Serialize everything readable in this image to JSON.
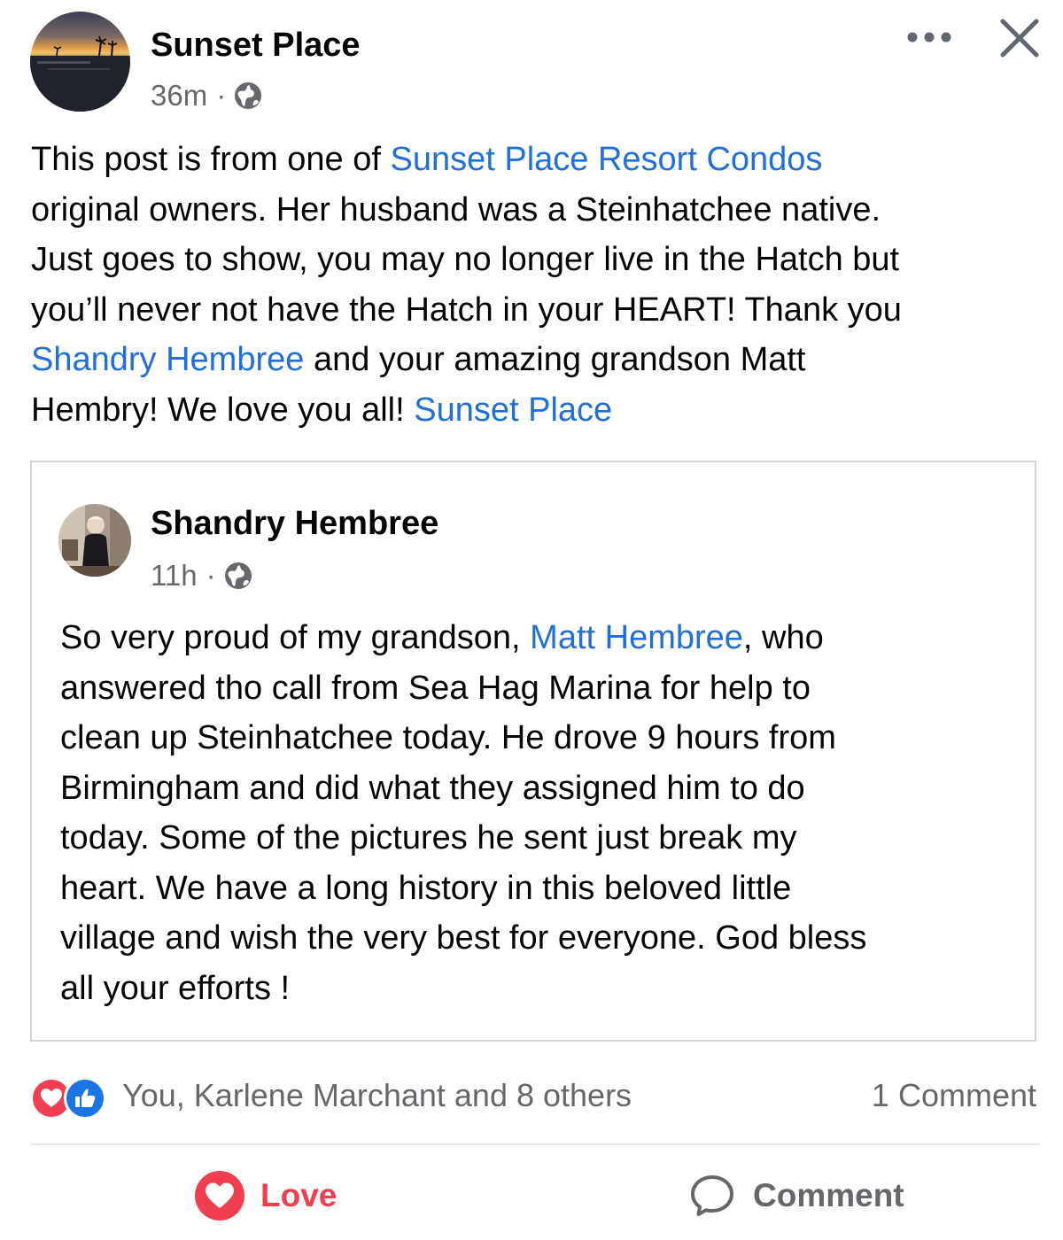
{
  "post": {
    "author": "Sunset Place",
    "time": "36m",
    "separator": "·",
    "lines": [
      [
        {
          "t": "This post is from one of "
        },
        {
          "t": "Sunset Place Resort Condos",
          "link": true
        }
      ],
      [
        {
          "t": "original owners. Her husband was a Steinhatchee native."
        }
      ],
      [
        {
          "t": "Just goes to show, you may no longer live in the Hatch but"
        }
      ],
      [
        {
          "t": "you’ll never not have the Hatch in your HEART! Thank you"
        }
      ],
      [
        {
          "t": "Shandry Hembree",
          "link": true
        },
        {
          "t": " and your amazing grandson Matt"
        }
      ],
      [
        {
          "t": "Hembry! We love you all! "
        },
        {
          "t": "Sunset Place",
          "link": true
        }
      ]
    ]
  },
  "shared": {
    "author": "Shandry Hembree",
    "time": "11h",
    "separator": "·",
    "lines": [
      [
        {
          "t": "So very proud of my grandson, "
        },
        {
          "t": "Matt Hembree",
          "link": true
        },
        {
          "t": ", who"
        }
      ],
      [
        {
          "t": "answered tho call from Sea Hag Marina for help to"
        }
      ],
      [
        {
          "t": "clean up Steinhatchee  today. He drove 9 hours from"
        }
      ],
      [
        {
          "t": "Birmingham and did what they assigned him to do"
        }
      ],
      [
        {
          "t": "today. Some of the pictures he sent just break my"
        }
      ],
      [
        {
          "t": "heart. We have a long history in this beloved little"
        }
      ],
      [
        {
          "t": "village and wish the very best for everyone. God bless"
        }
      ],
      [
        {
          "t": "all your efforts !"
        }
      ]
    ]
  },
  "footer": {
    "reactions_text": "You, Karlene Marchant and 8 others",
    "comment_count": "1 Comment",
    "love_label": "Love",
    "comment_label": "Comment"
  },
  "icons": {
    "more": "more-options-icon",
    "close": "close-icon",
    "audience": "globe-icon",
    "love_reaction": "heart-icon",
    "like_reaction": "thumbs-up-icon",
    "comment": "speech-bubble-icon"
  },
  "colors": {
    "link": "#216fdb",
    "love": "#f0404f",
    "like": "#1b74e4",
    "muted": "#65676b"
  }
}
